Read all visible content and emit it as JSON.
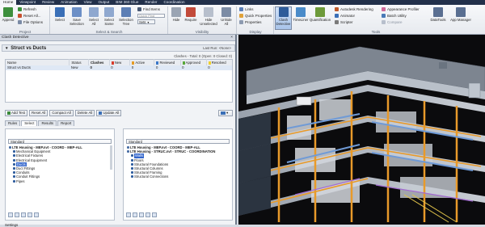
{
  "ribbon_tabs": [
    "Home",
    "Viewpoint",
    "Review",
    "Animation",
    "View",
    "Output",
    "BIM 360 Glue",
    "Render",
    "Coordination"
  ],
  "project_group": {
    "label": "Project",
    "append": "Append",
    "refresh": "Refresh",
    "reset_all": "Reset All...",
    "file_options": "File Options"
  },
  "select_group": {
    "label": "Select & Search",
    "select": "Select",
    "save_selection": "Save Selection",
    "select_all": "Select All",
    "select_same": "Select Same",
    "selection_tree": "Selection Tree",
    "find_items": "Find Items",
    "quick_find_placeholder": "Quick Find",
    "sets": "Sets"
  },
  "visibility_group": {
    "label": "Visibility",
    "hide": "Hide",
    "require": "Require",
    "hide_unselected": "Hide Unselected",
    "unhide_all": "Unhide All"
  },
  "display_group": {
    "label": "Display",
    "links": "Links",
    "quick_properties": "Quick Properties",
    "properties": "Properties"
  },
  "tools_group": {
    "label": "Tools",
    "clash_detective": "Clash Detective",
    "timeliner": "TimeLiner",
    "quantification": "Quantification",
    "autodesk_rendering": "Autodesk Rendering",
    "animator": "Animator",
    "scripter": "Scripter",
    "appearance_profiler": "Appearance Profiler",
    "batch_utility": "Batch Utility",
    "compare": "Compare",
    "datatools": "DataTools",
    "app_manager": "App Manager"
  },
  "panel": {
    "title": "Clash Detective",
    "close": "×",
    "test_name": "Struct vs Ducts",
    "last_run": "Last Run: <None>",
    "summary": "Clashes - Total: 0 (Open: 0 Closed: 0)",
    "columns": [
      "Name",
      "Status",
      "Clashes",
      "New",
      "Active",
      "Reviewed",
      "Approved",
      "Resolved"
    ],
    "rows": [
      {
        "name": "Struct vs Ducts",
        "status": "New",
        "clashes": "0",
        "new": "0",
        "active": "0",
        "reviewed": "0",
        "approved": "0",
        "resolved": "0"
      }
    ],
    "buttons": {
      "add_test": "Add Test",
      "reset_all": "Reset All",
      "compact_all": "Compact All",
      "delete_all": "Delete All",
      "update_all": "Update All"
    },
    "subtabs": [
      "Rules",
      "Select",
      "Results",
      "Report"
    ],
    "selection_a": {
      "label": "Selection A",
      "dropdown": "Standard",
      "items": [
        {
          "text": "LTE Housing - MEP.nvt - COORD - MEP-ALL",
          "root": true
        },
        {
          "text": "Mechanical Equipment"
        },
        {
          "text": "Electrical Fixtures"
        },
        {
          "text": "Electrical Equipment"
        },
        {
          "text": "Ducts",
          "selected": true
        },
        {
          "text": "Duct Fittings"
        },
        {
          "text": "Conduits"
        },
        {
          "text": "Conduit Fittings"
        },
        {
          "text": "Pipes"
        }
      ]
    },
    "selection_b": {
      "label": "Selection B",
      "dropdown": "Standard",
      "items": [
        {
          "text": "LTE Housing - MEP.nvt - COORD - MEP-ALL",
          "root": true
        },
        {
          "text": "LTE Housing - STRUC.nvt - STRUC - COORDINATION",
          "root": true
        },
        {
          "text": "Walls",
          "selected": true
        },
        {
          "text": "Floors"
        },
        {
          "text": "Structural Foundations"
        },
        {
          "text": "Structural Columns"
        },
        {
          "text": "Structural Framing"
        },
        {
          "text": "Structural Connections"
        }
      ]
    },
    "settings_label": "Settings",
    "settings_type": "Type: Hard",
    "settings_tolerance": "Tolerance: 0.001 m"
  },
  "colors": {
    "new": "#d93b2b",
    "active": "#e69c24",
    "reviewed": "#3a78c9",
    "approved": "#58a83a",
    "resolved": "#f0d02a"
  }
}
